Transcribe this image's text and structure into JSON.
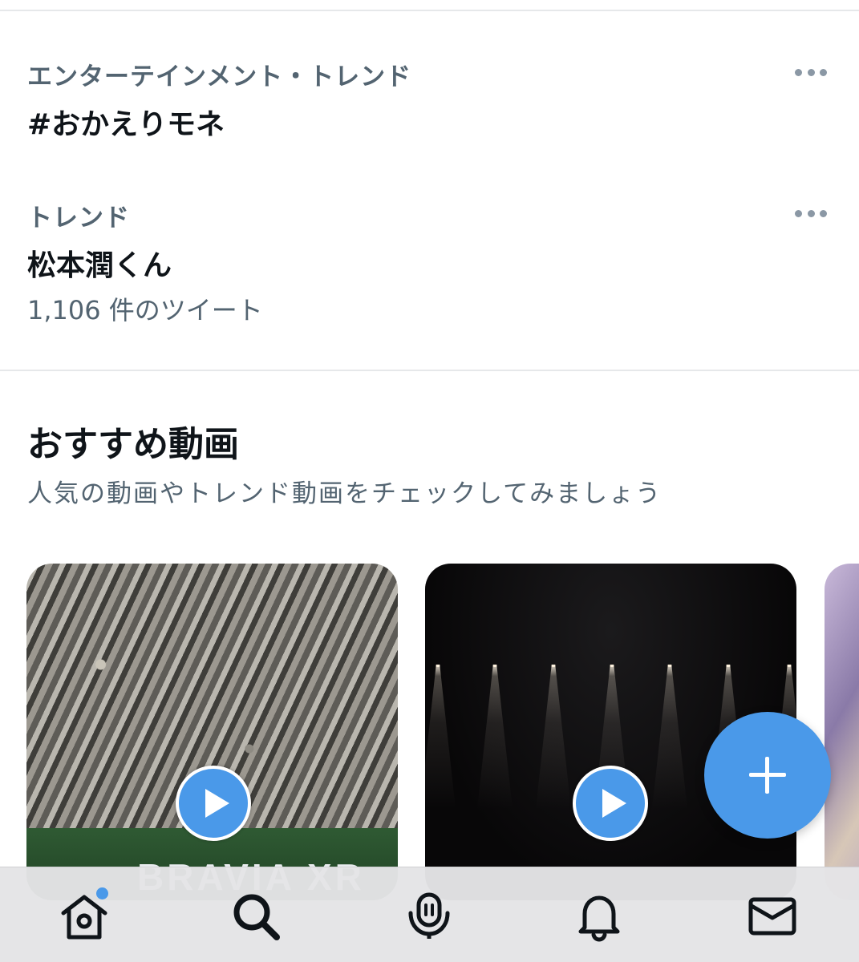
{
  "trends": [
    {
      "category": "エンターテインメント・トレンド",
      "title": "#おかえりモネ"
    },
    {
      "category": "トレンド",
      "title": "松本潤くん",
      "tweet_count": "1,106 件のツイート"
    }
  ],
  "video_section": {
    "title": "おすすめ動画",
    "subtitle": "人気の動画やトレンド動画をチェックしてみましょう",
    "cards": [
      {
        "overlay_text": "BRAVIA XR"
      }
    ]
  },
  "icons": {
    "more": "more-horizontal-icon",
    "play": "play-icon",
    "compose": "plus-icon",
    "home": "home-icon",
    "search": "search-icon",
    "spaces": "spaces-mic-icon",
    "notifications": "bell-icon",
    "messages": "envelope-icon"
  },
  "colors": {
    "accent": "#4a99e9",
    "secondary_text": "#536471",
    "primary_text": "#0f1419"
  },
  "tab_bar": {
    "home_has_new": true
  }
}
